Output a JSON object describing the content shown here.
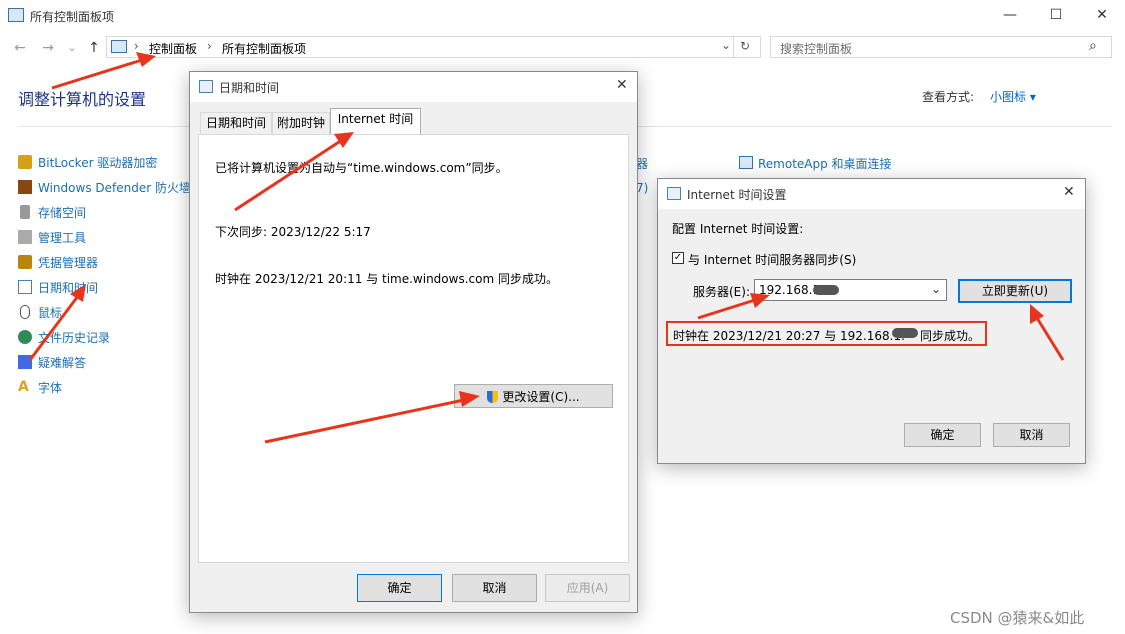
{
  "window": {
    "title": "所有控制面板项",
    "controls": {
      "minimize": "—",
      "maximize": "☐",
      "close": "✕"
    }
  },
  "address": {
    "back": "←",
    "forward": "→",
    "recent": "⌄",
    "up": "↑",
    "crumbs": [
      "控制面板",
      "所有控制面板项"
    ],
    "separator": "›",
    "dropdown": "⌄",
    "refresh": "↻",
    "search_placeholder": "搜索控制面板",
    "search_icon": "⌕"
  },
  "main": {
    "heading": "调整计算机的设置",
    "view_by_label": "查看方式:",
    "view_by_value": "小图标 ▾",
    "items": [
      {
        "label": "BitLocker 驱动器加密",
        "icon": "key-icon",
        "color": "#d4a017"
      },
      {
        "label": "Windows Defender 防火墙",
        "icon": "firewall-icon",
        "color": "#8b4513"
      },
      {
        "label": "存储空间",
        "icon": "storage-icon",
        "color": "#777777"
      },
      {
        "label": "管理工具",
        "icon": "tools-icon",
        "color": "#888888"
      },
      {
        "label": "凭据管理器",
        "icon": "vault-icon",
        "color": "#b8860b"
      },
      {
        "label": "日期和时间",
        "icon": "clock-icon",
        "color": "#4682b4"
      },
      {
        "label": "鼠标",
        "icon": "mouse-icon",
        "color": "#555555"
      },
      {
        "label": "文件历史记录",
        "icon": "history-icon",
        "color": "#2e8b57"
      },
      {
        "label": "疑难解答",
        "icon": "troubleshoot-icon",
        "color": "#4169e1"
      },
      {
        "label": "字体",
        "icon": "font-icon",
        "color": "#daa520"
      }
    ],
    "partial_item_1": "器",
    "partial_item_2": "7)",
    "remoteapp_label": "RemoteApp 和桌面连接"
  },
  "datetime_dialog": {
    "title": "日期和时间",
    "tabs": [
      "日期和时间",
      "附加时钟",
      "Internet 时间"
    ],
    "sync_text": "已将计算机设置为自动与“time.windows.com”同步。",
    "next_sync": "下次同步: 2023/12/22 5:17",
    "last_sync": "时钟在 2023/12/21 20:11 与 time.windows.com 同步成功。",
    "change_settings": "更改设置(C)...",
    "ok": "确定",
    "cancel": "取消",
    "apply": "应用(A)"
  },
  "inet_dialog": {
    "title": "Internet 时间设置",
    "config_label": "配置 Internet 时间设置:",
    "sync_checkbox": "与 Internet 时间服务器同步(S)",
    "sync_checked": true,
    "server_label": "服务器(E):",
    "server_value": "192.168.1",
    "update_now": "立即更新(U)",
    "result_prefix": "时钟在 2023/12/21 20:27 与 192.168.1.",
    "result_suffix": "同步成功。",
    "ok": "确定",
    "cancel": "取消"
  },
  "watermark": "CSDN @猿来&如此",
  "colors": {
    "arrow": "#e8341c",
    "highlight_box": "#e8341c",
    "link": "#1a6fb5",
    "heading": "#1e3287"
  }
}
